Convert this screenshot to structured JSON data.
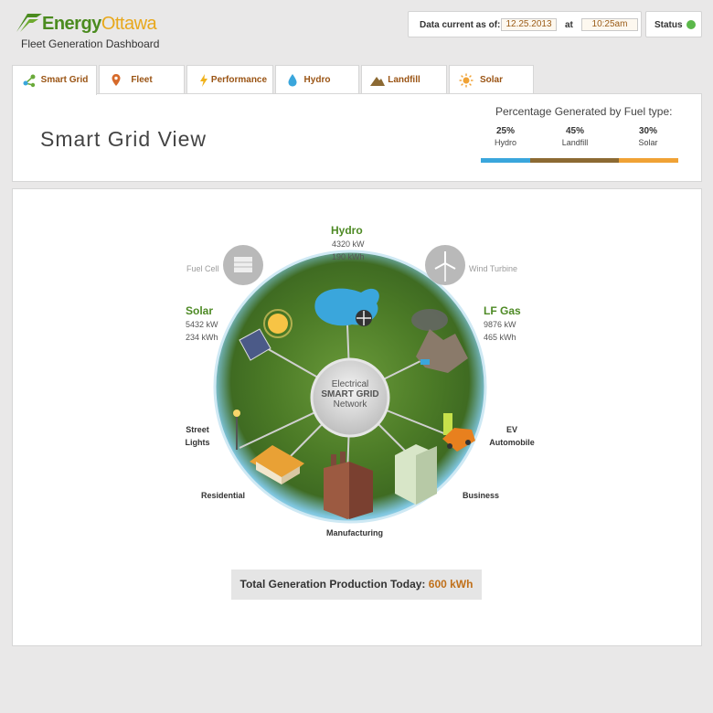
{
  "header": {
    "logo_energy": "Energy",
    "logo_city": "Ottawa",
    "subtitle": "Fleet Generation Dashboard",
    "data_current_label": "Data current as of:",
    "date": "12.25.2013",
    "at_label": "at",
    "time": "10:25am",
    "status_label": "Status",
    "status_color": "#5bb84a"
  },
  "tabs": [
    {
      "label": "Smart Grid",
      "icon": "network-icon",
      "active": true
    },
    {
      "label": "Fleet",
      "icon": "map-pin-icon",
      "active": false
    },
    {
      "label": "Performance",
      "icon": "lightning-icon",
      "active": false
    },
    {
      "label": "Hydro",
      "icon": "water-drop-icon",
      "active": false
    },
    {
      "label": "Landfill",
      "icon": "mountain-icon",
      "active": false
    },
    {
      "label": "Solar",
      "icon": "sun-icon",
      "active": false
    }
  ],
  "summary": {
    "page_title": "Smart Grid View",
    "pct_title": "Percentage Generated by Fuel type:",
    "fuels": [
      {
        "pct": "25%",
        "name": "Hydro",
        "color": "#3aa6dc"
      },
      {
        "pct": "45%",
        "name": "Landfill",
        "color": "#8c6a33"
      },
      {
        "pct": "30%",
        "name": "Solar",
        "color": "#f0a235"
      }
    ]
  },
  "grid": {
    "center_line1": "Electrical",
    "center_line2": "SMART GRID",
    "center_line3": "Network",
    "hydro": {
      "title": "Hydro",
      "kw": "4320 kW",
      "kwh": "190 kWh"
    },
    "solar": {
      "title": "Solar",
      "kw": "5432 kW",
      "kwh": "234 kWh"
    },
    "lfgas": {
      "title": "LF Gas",
      "kw": "9876 kW",
      "kwh": "465 kWh"
    },
    "fuel_cell": "Fuel Cell",
    "wind_turbine": "Wind Turbine",
    "street_lights_1": "Street",
    "street_lights_2": "Lights",
    "ev_1": "EV",
    "ev_2": "Automobile",
    "residential": "Residential",
    "business": "Business",
    "manufacturing": "Manufacturing"
  },
  "total": {
    "label": "Total Generation Production Today:",
    "value": "600 kWh"
  }
}
